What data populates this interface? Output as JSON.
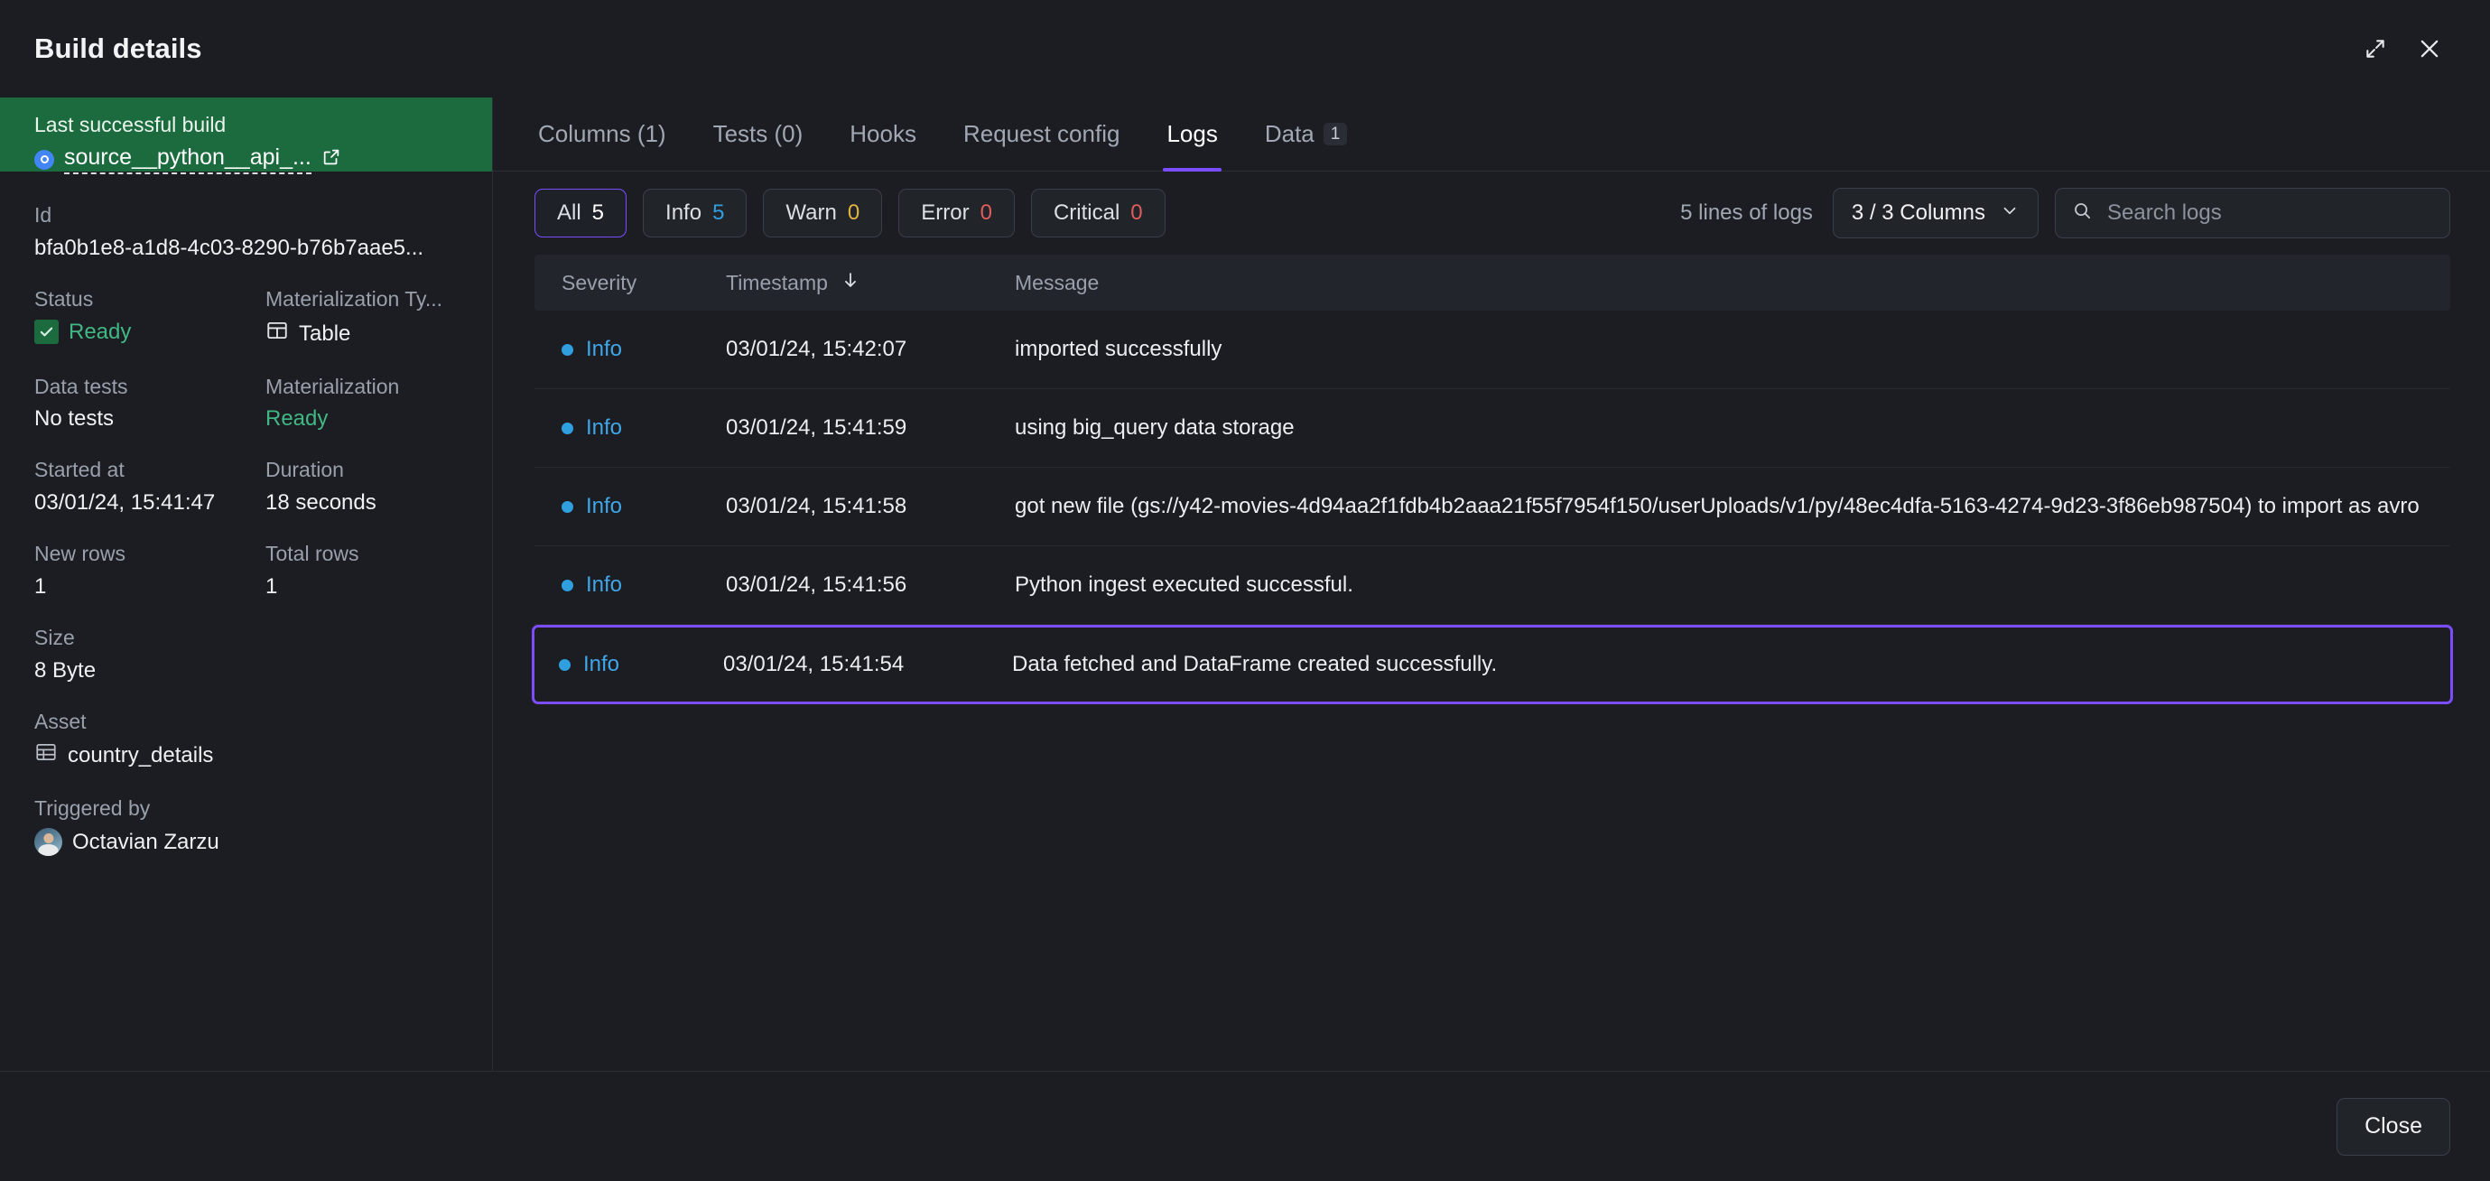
{
  "window": {
    "title": "Build details",
    "expand_icon": "expand-icon",
    "close_icon": "close-icon"
  },
  "sidebar": {
    "last_build": {
      "label": "Last successful build",
      "source_name": "source__python__api_...",
      "source_icon": "google-cloud-icon",
      "external_link_icon": "external-link-icon"
    },
    "fields": [
      {
        "label": "Id",
        "value": "bfa0b1e8-a1d8-4c03-8290-b76b7aae5..."
      },
      {
        "label": "Status",
        "value": "Ready"
      },
      {
        "label": "Materialization Ty...",
        "value": "Table"
      },
      {
        "label": "Data tests",
        "value": "No tests"
      },
      {
        "label": "Materialization",
        "value": "Ready"
      },
      {
        "label": "Started at",
        "value": "03/01/24, 15:41:47"
      },
      {
        "label": "Duration",
        "value": "18 seconds"
      },
      {
        "label": "New rows",
        "value": "1"
      },
      {
        "label": "Total rows",
        "value": "1"
      },
      {
        "label": "Size",
        "value": "8 Byte"
      },
      {
        "label": "Asset",
        "value": "country_details"
      },
      {
        "label": "Triggered by",
        "value": "Octavian Zarzu"
      }
    ]
  },
  "tabs": [
    {
      "label": "Columns (1)",
      "active": false,
      "badge": null
    },
    {
      "label": "Tests (0)",
      "active": false,
      "badge": null
    },
    {
      "label": "Hooks",
      "active": false,
      "badge": null
    },
    {
      "label": "Request config",
      "active": false,
      "badge": null
    },
    {
      "label": "Logs",
      "active": true,
      "badge": null
    },
    {
      "label": "Data",
      "active": false,
      "badge": "1"
    }
  ],
  "toolbar": {
    "filters": [
      {
        "label": "All",
        "count": "5",
        "selected": true,
        "color": "#ffffff"
      },
      {
        "label": "Info",
        "count": "5",
        "selected": false,
        "color": "#2f9fe0"
      },
      {
        "label": "Warn",
        "count": "0",
        "selected": false,
        "color": "#e3b341"
      },
      {
        "label": "Error",
        "count": "0",
        "selected": false,
        "color": "#e05c5c"
      },
      {
        "label": "Critical",
        "count": "0",
        "selected": false,
        "color": "#e05c5c"
      }
    ],
    "lines_label": "5 lines of logs",
    "columns_select": "3 / 3 Columns",
    "columns_chevron_icon": "chevron-down-icon",
    "search_icon": "search-icon",
    "search_value": "",
    "search_placeholder": "Search logs"
  },
  "log_table": {
    "columns": [
      "Severity",
      "Timestamp",
      "Message"
    ],
    "sort_column": "Timestamp",
    "sort_icon": "arrow-down-icon",
    "rows": [
      {
        "severity": "Info",
        "timestamp": "03/01/24, 15:42:07",
        "message": "imported successfully",
        "highlighted": false
      },
      {
        "severity": "Info",
        "timestamp": "03/01/24, 15:41:59",
        "message": "using big_query data storage",
        "highlighted": false
      },
      {
        "severity": "Info",
        "timestamp": "03/01/24, 15:41:58",
        "message": "got new file (gs://y42-movies-4d94aa2f1fdb4b2aaa21f55f7954f150/userUploads/v1/py/48ec4dfa-5163-4274-9d23-3f86eb987504) to import as avro",
        "highlighted": false
      },
      {
        "severity": "Info",
        "timestamp": "03/01/24, 15:41:56",
        "message": "Python ingest executed successful.",
        "highlighted": false
      },
      {
        "severity": "Info",
        "timestamp": "03/01/24, 15:41:54",
        "message": "Data fetched and DataFrame created successfully.",
        "highlighted": true
      }
    ]
  },
  "footer": {
    "close_label": "Close"
  },
  "colors": {
    "accent": "#7c4dff",
    "success": "#1c6b3f",
    "success_text": "#41b883",
    "info": "#2f9fe0",
    "warn": "#e3b341",
    "error": "#e05c5c",
    "panel": "#1b1d23"
  }
}
